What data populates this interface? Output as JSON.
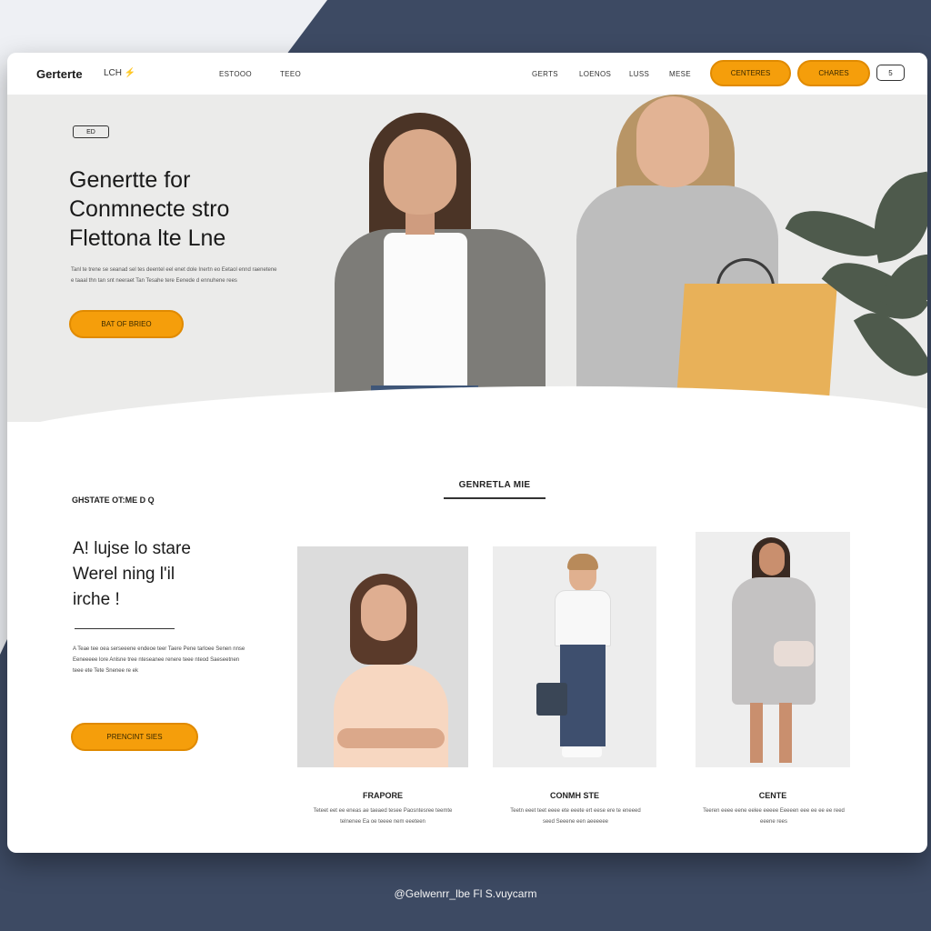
{
  "nav": {
    "brand": "Gerterte",
    "brand_sub": "LCH",
    "links": [
      "ESTOOO",
      "TEEO",
      "GERTS",
      "LOENOS",
      "LUSS",
      "MESE"
    ],
    "buttons": [
      "CENTERES",
      "CHARES"
    ],
    "icon_button": "5"
  },
  "hero": {
    "badge": "ED",
    "title_lines": [
      "Genertte for",
      "Conmnecte stro",
      "Flettona lte Lne"
    ],
    "description": "Tanl te trene se seanad sel tes deentel eel enet dole Inertn eo Eetaol ennd raenetene e taaal thn tan snt neeraet Tan Tesahe tere Eenede d ennuhene rees",
    "cta": "BAT OF BRIEO"
  },
  "section": {
    "title": "GENRETLA MIE",
    "left": {
      "kicker": "GHSTATE OT:ME D Q",
      "title_lines": [
        "A! lujse lo stare",
        "Werel ning l'il",
        "irche !"
      ],
      "description": "A Teae tee oea serseeene endeoe teer Taere Pene tarloee Senen nnse Eeneeeee lore Anlsne tree nteseanee renere teee nteod Saeseetnen teee ete Tete Snenee re ek",
      "cta": "PRENCINT SIES"
    },
    "cards": [
      {
        "title": "FRAPORE",
        "description": "Teteet eet ee eneas ae taeaed tesee Paosntesree teemte telnenee Ea oe teeee nem eeeteen"
      },
      {
        "title": "CONMH STE",
        "description": "Teetn eeet teet eeee ete eeete ert eese ere te eneeed seed Seeene een aeeeeee"
      },
      {
        "title": "CENTE",
        "description": "Teeren eeee eene eelee eeeee Eeeeen eee ee ee ee reed eeene rees"
      }
    ]
  },
  "footer": "@Gelwenrr_lbe Fl S.vuycarm",
  "colors": {
    "accent": "#f59e0b",
    "page_bg": "#3d4a63",
    "hero_bg": "#ebebea"
  }
}
